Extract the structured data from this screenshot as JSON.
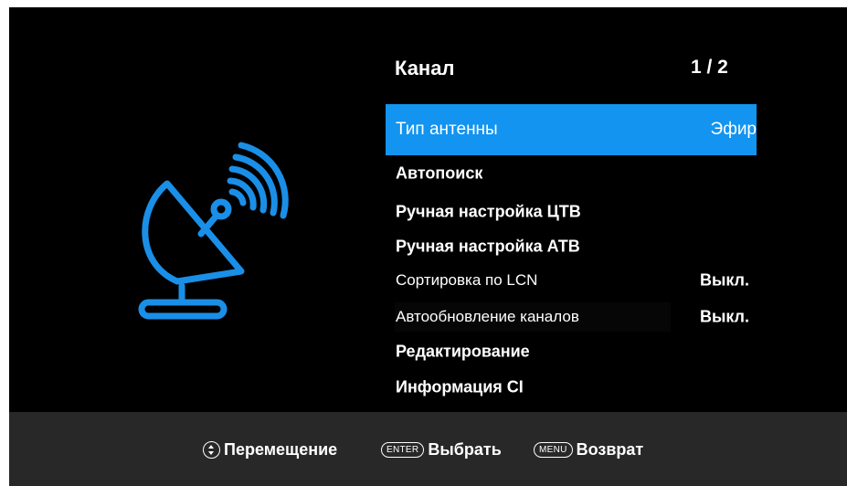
{
  "menu": {
    "title": "Канал",
    "page": "1 / 2",
    "items": [
      {
        "label": "Тип антенны",
        "value": "Эфир",
        "selected": true
      },
      {
        "label": "Автопоиск",
        "value": ""
      },
      {
        "label": "Ручная настройка ЦТВ",
        "value": ""
      },
      {
        "label": "Ручная настройка АТВ",
        "value": ""
      },
      {
        "label": "Сортировка по LCN",
        "value": "Выкл."
      },
      {
        "label": "Автообновление каналов",
        "value": "Выкл."
      },
      {
        "label": "Редактирование",
        "value": ""
      },
      {
        "label": "Информация CI",
        "value": ""
      }
    ]
  },
  "footer": {
    "move_label": "Перемещение",
    "enter_key": "ENTER",
    "select_label": "Выбрать",
    "menu_key": "MENU",
    "back_label": "Возврат"
  },
  "colors": {
    "accent": "#1294f0",
    "icon": "#1a8fe8",
    "background": "#000000",
    "footer": "#282828"
  },
  "icons": [
    "satellite-dish-icon",
    "up-down-arrows-icon"
  ]
}
